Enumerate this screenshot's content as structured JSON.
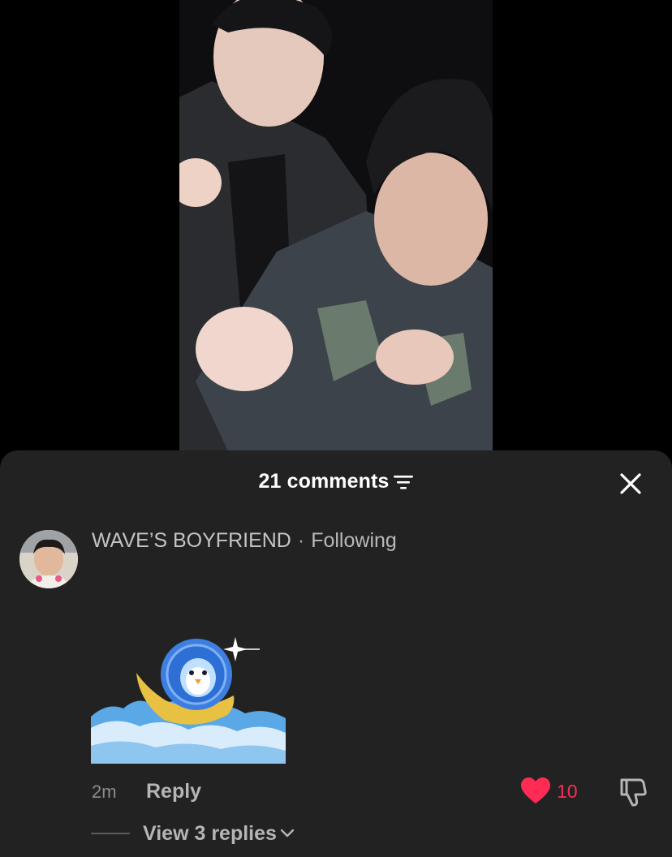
{
  "video": {
    "description_icon": "video-frame"
  },
  "comments_sheet": {
    "count_label": "21 comments",
    "sort_icon": "filter-lines-icon",
    "close_icon": "close-icon"
  },
  "comment": {
    "username": "WAVE’S BOYFRIEND",
    "separator": "·",
    "follow_status": "Following",
    "time": "2m",
    "reply_label": "Reply",
    "like_count": "10",
    "like_icon": "heart-icon",
    "dislike_icon": "thumbs-down-icon",
    "view_replies_label": "View 3 replies",
    "sticker_icon": "penguin-coin-sticker"
  },
  "colors": {
    "sheet_bg": "#222223",
    "like_accent": "#fe2c55",
    "text_primary": "#ffffff",
    "text_secondary": "#b5b5b5"
  }
}
